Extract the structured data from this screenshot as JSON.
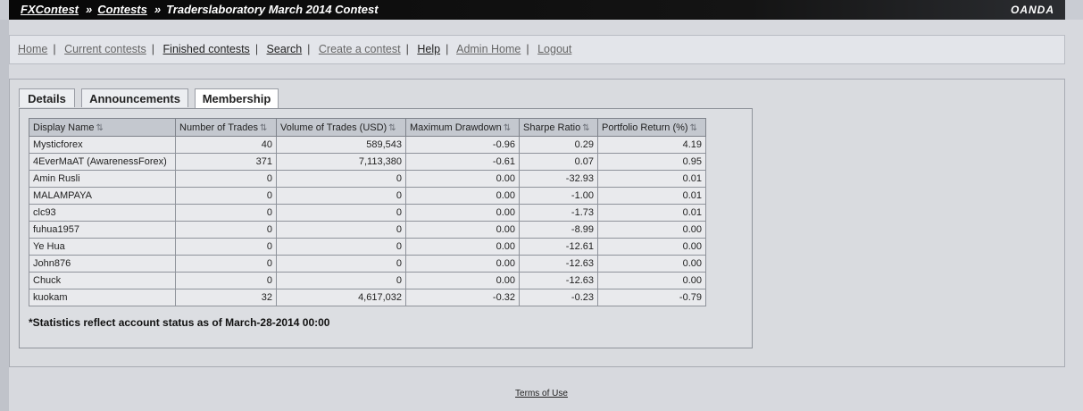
{
  "header": {
    "crumbs": [
      "FXContest",
      "Contests"
    ],
    "separator": "»",
    "current": "Traderslaboratory March 2014 Contest",
    "logo": "OANDA"
  },
  "nav": {
    "items": [
      "Home",
      "Current contests",
      "Finished contests",
      "Search",
      "Create a contest",
      "Help",
      "Admin Home",
      "Logout"
    ],
    "separator": "|"
  },
  "tabs": {
    "details": "Details",
    "announcements": "Announcements",
    "membership": "Membership"
  },
  "table": {
    "columns": [
      "Display Name",
      "Number of Trades",
      "Volume of Trades (USD)",
      "Maximum Drawdown",
      "Sharpe Ratio",
      "Portfolio Return (%)"
    ],
    "rows": [
      [
        "Mysticforex",
        "40",
        "589,543",
        "-0.96",
        "0.29",
        "4.19"
      ],
      [
        "4EverMaAT (AwarenessForex)",
        "371",
        "7,113,380",
        "-0.61",
        "0.07",
        "0.95"
      ],
      [
        "Amin Rusli",
        "0",
        "0",
        "0.00",
        "-32.93",
        "0.01"
      ],
      [
        "MALAMPAYA",
        "0",
        "0",
        "0.00",
        "-1.00",
        "0.01"
      ],
      [
        "clc93",
        "0",
        "0",
        "0.00",
        "-1.73",
        "0.01"
      ],
      [
        "fuhua1957",
        "0",
        "0",
        "0.00",
        "-8.99",
        "0.00"
      ],
      [
        "Ye Hua",
        "0",
        "0",
        "0.00",
        "-12.61",
        "0.00"
      ],
      [
        "John876",
        "0",
        "0",
        "0.00",
        "-12.63",
        "0.00"
      ],
      [
        "Chuck",
        "0",
        "0",
        "0.00",
        "-12.63",
        "0.00"
      ],
      [
        "kuokam",
        "32",
        "4,617,032",
        "-0.32",
        "-0.23",
        "-0.79"
      ]
    ]
  },
  "footnote": "*Statistics reflect account status as of March-28-2014 00:00",
  "footer": {
    "terms": "Terms of Use"
  },
  "icons": {
    "sort": "sort-icon",
    "sort_glyph": "⇅"
  }
}
